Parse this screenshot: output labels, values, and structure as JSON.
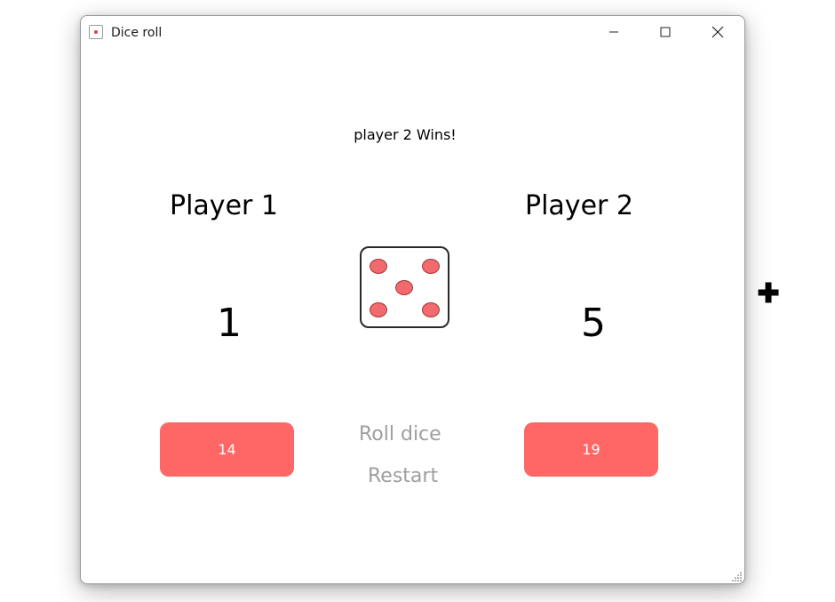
{
  "window": {
    "title": "Dice roll",
    "controls": [
      "minimize",
      "maximize",
      "close"
    ]
  },
  "game": {
    "status": "player 2 Wins!",
    "player1": {
      "label": "Player 1",
      "roll": "1",
      "total": "14"
    },
    "player2": {
      "label": "Player 2",
      "roll": "5",
      "total": "19"
    },
    "dice_value": 5
  },
  "actions": {
    "roll_label": "Roll dice",
    "restart_label": "Restart"
  },
  "icons": {
    "app": "dice-icon",
    "minimize": "minimize-icon",
    "maximize": "maximize-icon",
    "close": "close-icon",
    "cursor": "crosshair-plus-cursor"
  },
  "colors": {
    "accent": "#ff6666",
    "pip": "#f06a6e",
    "disabled_text": "#9e9e9e"
  }
}
